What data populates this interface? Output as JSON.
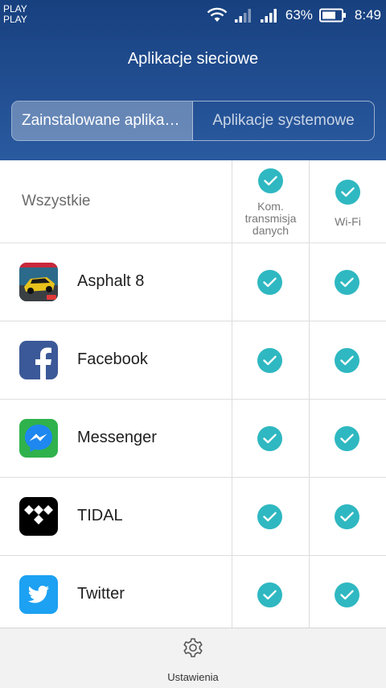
{
  "status_bar": {
    "carrier_line1": "PLAY",
    "carrier_line2": "PLAY",
    "battery_percent": "63%",
    "time": "8:49",
    "icons": [
      "wifi-icon",
      "signal-icon",
      "signal-icon",
      "battery-icon"
    ]
  },
  "header": {
    "title": "Aplikacje sieciowe"
  },
  "tabs": [
    {
      "label": "Zainstalowane aplikacje",
      "active": true
    },
    {
      "label": "Aplikacje systemowe",
      "active": false
    }
  ],
  "table": {
    "all_label": "Wszystkie",
    "columns": [
      {
        "label": "Kom. transmisja danych",
        "checked": true
      },
      {
        "label": "Wi-Fi",
        "checked": true
      }
    ],
    "apps": [
      {
        "name": "Asphalt 8",
        "icon": "asphalt-8-icon",
        "mobile_data": true,
        "wifi": true
      },
      {
        "name": "Facebook",
        "icon": "facebook-icon",
        "mobile_data": true,
        "wifi": true
      },
      {
        "name": "Messenger",
        "icon": "messenger-icon",
        "mobile_data": true,
        "wifi": true
      },
      {
        "name": "TIDAL",
        "icon": "tidal-icon",
        "mobile_data": true,
        "wifi": true
      },
      {
        "name": "Twitter",
        "icon": "twitter-icon",
        "mobile_data": true,
        "wifi": true
      }
    ]
  },
  "bottom": {
    "settings_label": "Ustawienia",
    "settings_icon": "gear-icon"
  },
  "colors": {
    "header_blue": "#1d4a8c",
    "check_teal": "#2fb8c1"
  }
}
